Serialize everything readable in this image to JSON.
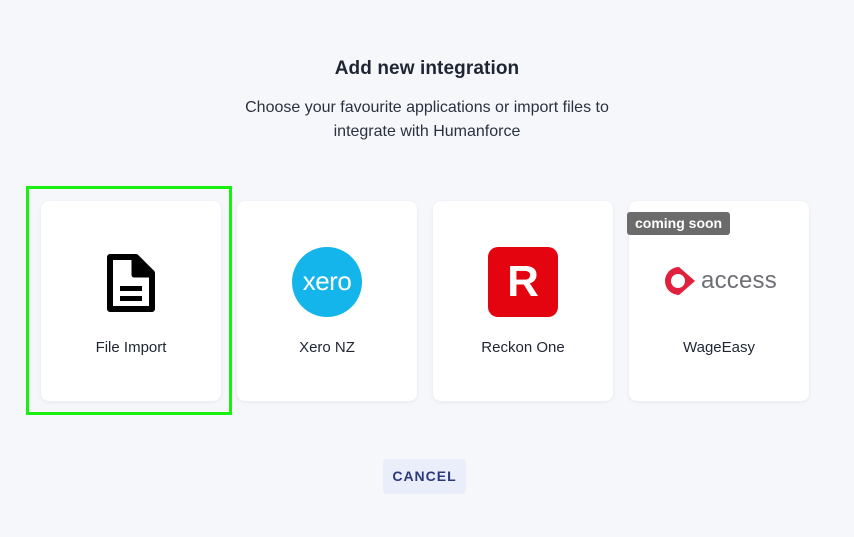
{
  "dialog": {
    "title": "Add new integration",
    "subtitle": "Choose your favourite applications or import files to integrate with Humanforce"
  },
  "integrations": [
    {
      "label": "File Import",
      "icon": "file-document-icon"
    },
    {
      "label": "Xero NZ",
      "icon": "xero-logo",
      "logo_text": "xero",
      "color": "#13b5ea"
    },
    {
      "label": "Reckon One",
      "icon": "reckon-logo",
      "logo_text": "R",
      "color": "#e4040f"
    },
    {
      "label": "WageEasy",
      "icon": "access-logo",
      "logo_text": "access",
      "color": "#e0203c",
      "badge": "coming soon"
    }
  ],
  "actions": {
    "cancel_label": "CANCEL"
  },
  "colors": {
    "background": "#f6f7fb",
    "selection_outline": "#1aef12",
    "cancel_background": "#eaedfa",
    "cancel_text": "#2c3a7a",
    "badge_background": "#6b6b6b"
  }
}
